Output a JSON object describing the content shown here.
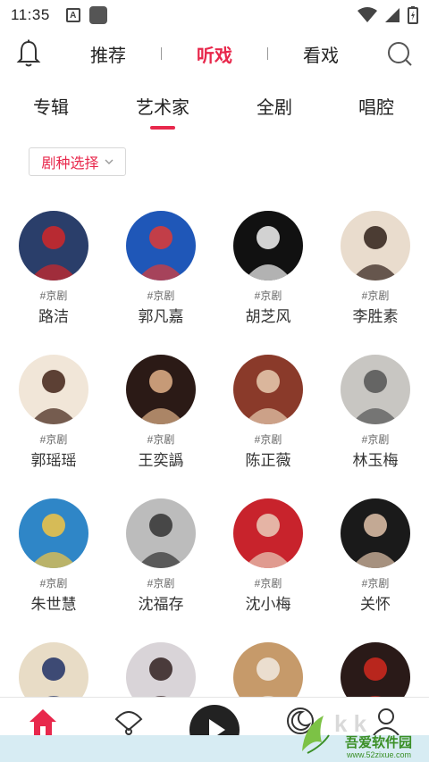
{
  "status": {
    "time": "11:35",
    "notif_letter": "A"
  },
  "topnav": {
    "items": [
      {
        "label": "推荐",
        "active": false
      },
      {
        "label": "听戏",
        "active": true
      },
      {
        "label": "看戏",
        "active": false
      }
    ]
  },
  "tabs": [
    {
      "label": "专辑"
    },
    {
      "label": "艺术家",
      "active": true
    },
    {
      "label": "全剧"
    },
    {
      "label": "唱腔"
    }
  ],
  "filter": {
    "label": "剧种选择"
  },
  "artists": [
    {
      "tag": "#京剧",
      "name": "路洁",
      "bg": "#2a3e6a",
      "fg": "#c8282c"
    },
    {
      "tag": "#京剧",
      "name": "郭凡嘉",
      "bg": "#1f57b8",
      "fg": "#d43c3c"
    },
    {
      "tag": "#京剧",
      "name": "胡芝风",
      "bg": "#111111",
      "fg": "#e8e8e8"
    },
    {
      "tag": "#京剧",
      "name": "李胜素",
      "bg": "#e9dccd",
      "fg": "#3a2a22"
    },
    {
      "tag": "#京剧",
      "name": "郭瑶瑶",
      "bg": "#f1e6d8",
      "fg": "#4b2e22"
    },
    {
      "tag": "#京剧",
      "name": "王奕譌",
      "bg": "#2b1a16",
      "fg": "#d7a982"
    },
    {
      "tag": "#京剧",
      "name": "陈正薇",
      "bg": "#8a3a2a",
      "fg": "#e2c4a8"
    },
    {
      "tag": "#京剧",
      "name": "林玉梅",
      "bg": "#c8c6c2",
      "fg": "#5a5a5a"
    },
    {
      "tag": "#京剧",
      "name": "朱世慧",
      "bg": "#2f86c7",
      "fg": "#e9c14a"
    },
    {
      "tag": "#京剧",
      "name": "沈福存",
      "bg": "#bcbcbc",
      "fg": "#3a3a3a"
    },
    {
      "tag": "#京剧",
      "name": "沈小梅",
      "bg": "#c8232c",
      "fg": "#e8c4b2"
    },
    {
      "tag": "#京剧",
      "name": "关怀",
      "bg": "#1a1a1a",
      "fg": "#d6b9a2"
    },
    {
      "tag": "",
      "name": "",
      "bg": "#e8dcc6",
      "fg": "#2a3a6a"
    },
    {
      "tag": "",
      "name": "",
      "bg": "#d9d4d8",
      "fg": "#3a2a2a"
    },
    {
      "tag": "",
      "name": "",
      "bg": "#c69a6a",
      "fg": "#eee6da"
    },
    {
      "tag": "",
      "name": "",
      "bg": "#2a1a18",
      "fg": "#c8281e"
    }
  ],
  "watermark": {
    "text": "吾爱软件园",
    "url": "www.52zixue.com"
  },
  "colors": {
    "accent": "#e8284c"
  }
}
